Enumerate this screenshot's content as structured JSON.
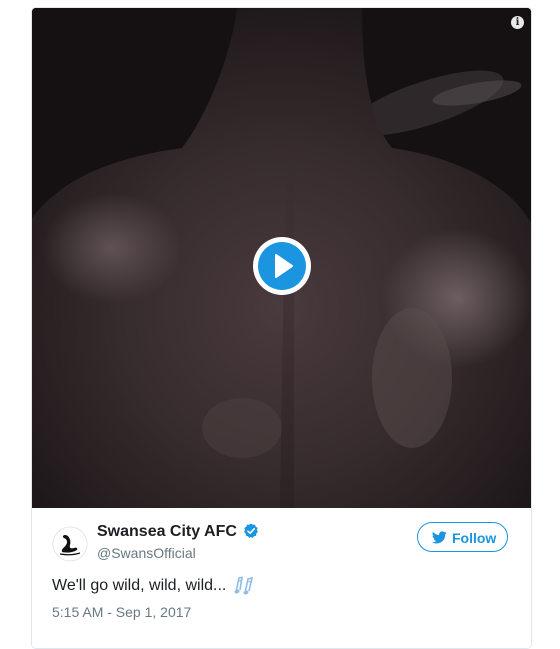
{
  "tweet": {
    "account_name": "Swansea City AFC",
    "handle": "@SwansOfficial",
    "verified": true,
    "follow_label": "Follow",
    "text": "We'll go wild, wild, wild...",
    "emoji": "musical-notes-icon",
    "timestamp": "5:15 AM - Sep 1, 2017"
  },
  "media": {
    "type": "video",
    "info_symbol": "i",
    "play_icon": "play-icon"
  },
  "colors": {
    "accent": "#1b95e0",
    "text_primary": "#1c2022",
    "text_secondary": "#697882",
    "border": "#e1e8ed"
  }
}
